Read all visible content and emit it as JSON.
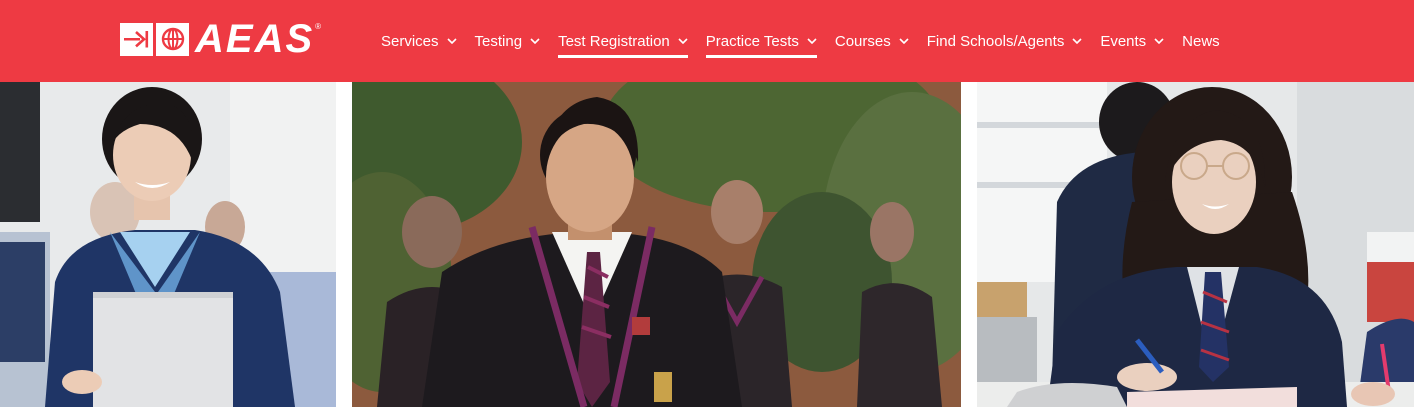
{
  "brand": {
    "logo_text": "AEAS",
    "registered_mark": "®"
  },
  "nav": {
    "items": [
      {
        "label": "Services",
        "has_dropdown": true,
        "underlined": false
      },
      {
        "label": "Testing",
        "has_dropdown": true,
        "underlined": false
      },
      {
        "label": "Test Registration",
        "has_dropdown": true,
        "underlined": true
      },
      {
        "label": "Practice Tests",
        "has_dropdown": true,
        "underlined": true
      },
      {
        "label": "Courses",
        "has_dropdown": true,
        "underlined": false
      },
      {
        "label": "Find Schools/Agents",
        "has_dropdown": true,
        "underlined": false
      },
      {
        "label": "Events",
        "has_dropdown": true,
        "underlined": false
      },
      {
        "label": "News",
        "has_dropdown": false,
        "underlined": false
      }
    ]
  },
  "colors": {
    "brand_red": "#ee3a43",
    "nav_text": "#ffffff",
    "uniform_navy": "#1f3566",
    "blazer_black": "#1d1a1e",
    "trim_purple": "#7b2b63"
  },
  "hero": {
    "photos": [
      {
        "subject": "smiling student in navy blazer holding laptop"
      },
      {
        "subject": "student in black blazer with purple trim"
      },
      {
        "subject": "smiling student with glasses writing at desk"
      }
    ]
  }
}
